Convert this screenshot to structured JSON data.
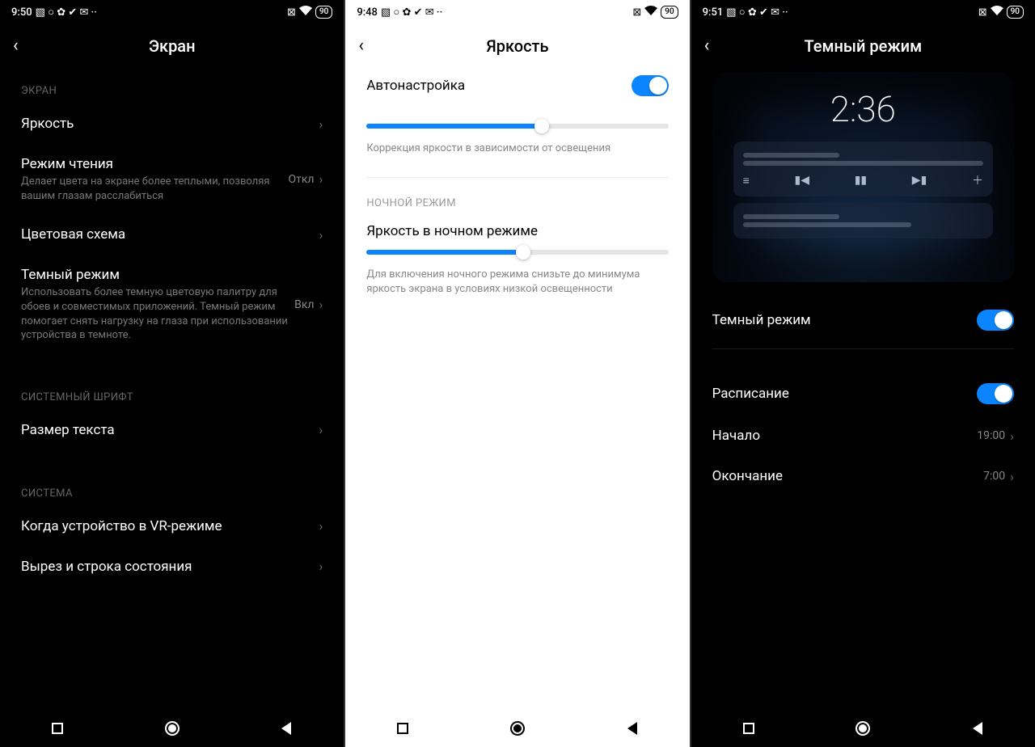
{
  "p1": {
    "time": "9:50",
    "batt": "90",
    "title": "Экран",
    "sec_screen": "ЭКРАН",
    "brightness": "Яркость",
    "reading": "Режим чтения",
    "reading_sub": "Делает цвета на экране более теплыми, позволяя вашим глазам расслабиться",
    "reading_val": "Откл",
    "colorscheme": "Цветовая схема",
    "darkmode": "Темный режим",
    "darkmode_sub": "Использовать более темную цветовую палитру для обоев и совместимых приложений. Темный режим помогает снять нагрузку на глаза при использовании устройства в темноте.",
    "darkmode_val": "Вкл",
    "sec_font": "СИСТЕМНЫЙ ШРИФТ",
    "textsize": "Размер текста",
    "sec_system": "СИСТЕМА",
    "vr": "Когда устройство в VR-режиме",
    "notch": "Вырез и строка состояния"
  },
  "p2": {
    "time": "9:48",
    "batt": "90",
    "title": "Яркость",
    "auto": "Автонастройка",
    "auto_on": true,
    "slider1_pct": 58,
    "hint1": "Коррекция яркости в зависимости от освещения",
    "sec_night": "НОЧНОЙ РЕЖИМ",
    "night_label": "Яркость в ночном режиме",
    "slider2_pct": 52,
    "hint2": "Для включения ночного режима снизьте до минимума яркость экрана в условиях низкой освещенности"
  },
  "p3": {
    "time": "9:51",
    "batt": "90",
    "title": "Темный режим",
    "preview_time": "2:36",
    "darkmode": "Темный режим",
    "darkmode_on": true,
    "schedule": "Расписание",
    "schedule_on": true,
    "start": "Начало",
    "start_val": "19:00",
    "end": "Окончание",
    "end_val": "7:00"
  }
}
